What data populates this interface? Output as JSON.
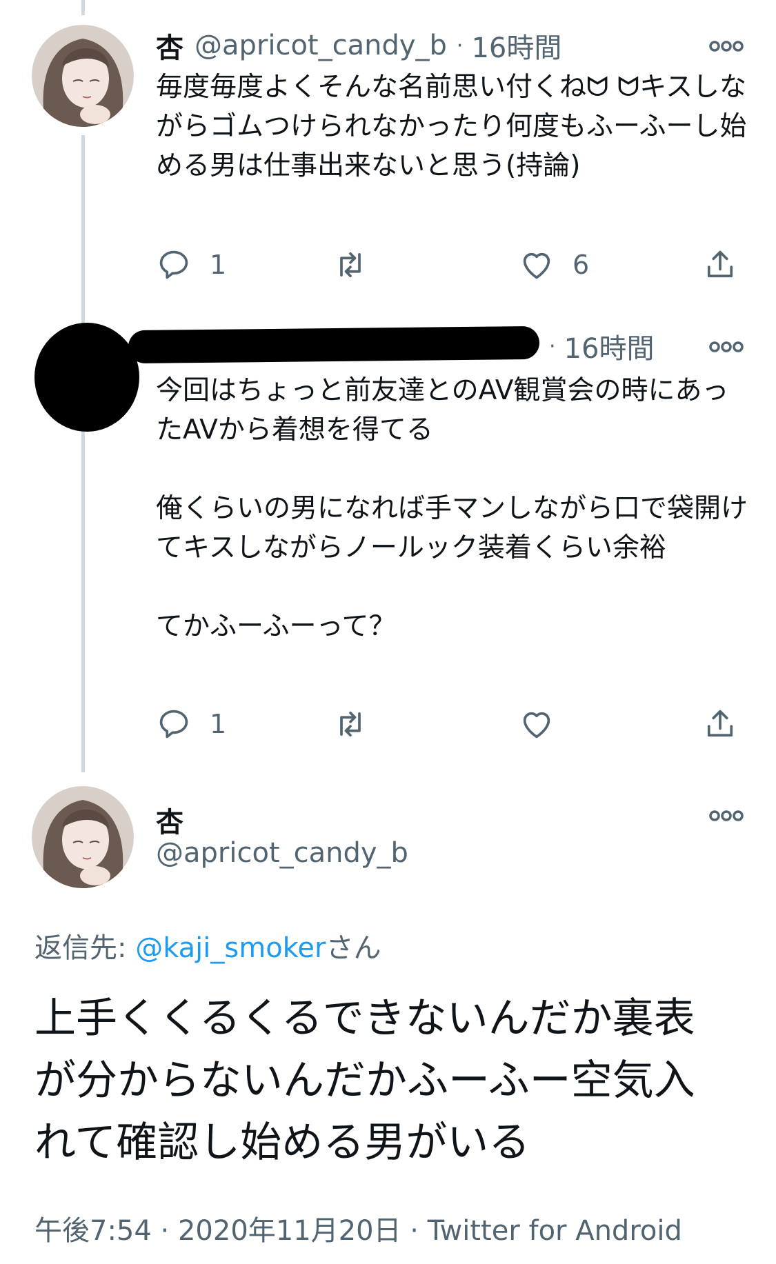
{
  "tweet1": {
    "name": "杏",
    "handle": "@apricot_candy_b",
    "sep": "·",
    "time": "16時間",
    "text": "毎度毎度よくそんな名前思い付くねᗢ ᗢキスしながらゴムつけられなかったり何度もふーふーし始める男は仕事出来ないと思う(持論)",
    "reply_count": "1",
    "retweet_count": "",
    "like_count": "6"
  },
  "tweet2": {
    "sep": "·",
    "time": "16時間",
    "text": "今回はちょっと前友達とのAV観賞会の時にあったAVから着想を得てる\n\n俺くらいの男になれば手マンしながら口で袋開けてキスしながらノールック装着くらい余裕\n\nてかふーふーって？",
    "reply_count": "1",
    "retweet_count": "",
    "like_count": ""
  },
  "main": {
    "name": "杏",
    "handle": "@apricot_candy_b",
    "reply_to_label": "返信先: ",
    "reply_to_handle": "@kaji_smoker",
    "reply_to_suffix": "さん",
    "text": "上手くくるくるできないんだか裏表が分からないんだかふーふー空気入れて確認し始める男がいる",
    "timestamp": "午後7:54 · 2020年11月20日",
    "source_sep": " · ",
    "source": "Twitter for Android"
  },
  "colors": {
    "text": "#0f1419",
    "muted": "#536471",
    "link": "#1d9bf0",
    "thread_line": "#cfd9de"
  },
  "icons": [
    "reply-icon",
    "retweet-icon",
    "like-icon",
    "share-icon",
    "more-icon"
  ]
}
